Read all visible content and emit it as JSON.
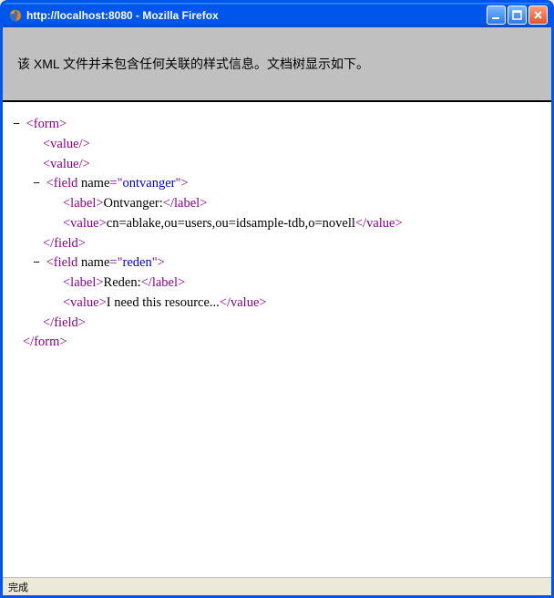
{
  "window": {
    "title": "http://localhost:8080 - Mozilla Firefox"
  },
  "banner": {
    "message": "该 XML 文件并未包含任何关联的样式信息。文档树显示如下。"
  },
  "toggle": "−",
  "xml": {
    "form_open": "<form>",
    "value_self": "<value/>",
    "field1_open_a": "<field ",
    "field1_attr": "name",
    "field1_eq": "=\"",
    "field1_val": "ontvanger",
    "field1_open_b": "\">",
    "label_open": "<label>",
    "label_close": "</label>",
    "label1_text": "Ontvanger:",
    "value_open": "<value>",
    "value_close": "</value>",
    "value1_text": "cn=ablake,ou=users,ou=idsample-tdb,o=novell",
    "field_close": "</field>",
    "field2_open_a": "<field ",
    "field2_attr": "name",
    "field2_eq": "=\"",
    "field2_val": "reden",
    "field2_open_b": "\">",
    "label2_text": "Reden:",
    "value2_text": "I need this resource...",
    "form_close": "</form>"
  },
  "statusbar": {
    "text": "完成"
  }
}
